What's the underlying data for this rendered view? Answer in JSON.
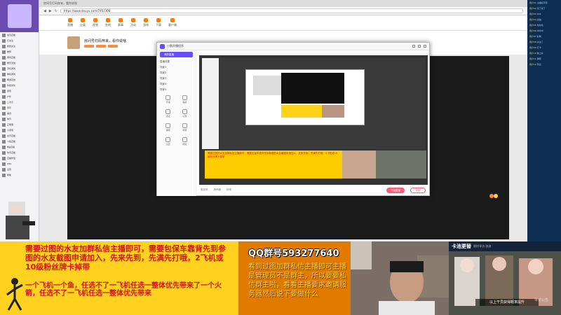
{
  "left_panel": {
    "items": [
      "最近直播",
      "已关注",
      "我的关注",
      "推荐",
      "游戏直播",
      "娱乐天地",
      "手机游戏",
      "单机游戏",
      "网游竞技",
      "科技文化",
      "颜值",
      "户外",
      "二次元",
      "音乐",
      "美食",
      "体育",
      "正能量",
      "小游戏",
      "虎牙直播",
      "斗鱼直播",
      "B站直播",
      "快手直播",
      "直播伴侣",
      "OBS",
      "设置",
      "帮助"
    ]
  },
  "browser": {
    "url": "https://www.douyu.com/7457308",
    "room_title": "房间号打码奔来，看你说啥",
    "nav": [
      "直播",
      "分类",
      "视频",
      "鱼吧",
      "赛事",
      "活动",
      "游戏",
      "下载",
      "客户端"
    ],
    "logo": "斗鱼"
  },
  "tool": {
    "title": "小鹅开播程序",
    "side_items": [
      "我的直播",
      "直播设置",
      "场景1",
      "场景2",
      "场景3",
      "场景4",
      "场景5"
    ],
    "grid_items": [
      "开播",
      "美颜",
      "连麦",
      "礼物",
      "弹幕",
      "录屏",
      "设置",
      "帮助"
    ],
    "bottom_items": [
      "麦克风",
      "扬声器",
      "码率"
    ],
    "live_button": "开始直播",
    "record_button": "录制"
  },
  "right_panel": {
    "rows": [
      {
        "user": "用户01",
        "text": "主播好厉害"
      },
      {
        "user": "用户02",
        "text": "来了来了"
      },
      {
        "user": "用户03",
        "text": "666"
      },
      {
        "user": "用户04",
        "text": "加油"
      },
      {
        "user": "用户05",
        "text": "哈哈哈"
      },
      {
        "user": "用户06",
        "text": "冲冲冲"
      },
      {
        "user": "用户07",
        "text": "好看"
      },
      {
        "user": "用户08",
        "text": "关注了"
      },
      {
        "user": "用户09",
        "text": "打卡"
      },
      {
        "user": "用户10",
        "text": "晚上好"
      },
      {
        "user": "用户11",
        "text": "弹幕"
      },
      {
        "user": "用户12",
        "text": "欢迎"
      }
    ]
  },
  "bottom": {
    "msg1": "需要过图的水友加群私信主播即可，需要包保车靠背先到参图的水友截图申请加入，先来先到，先满先打哦，2飞机或10级粉丝牌卡掉带",
    "msg2": "一个飞机一个鱼，任选不了一飞机任选一整体优先带来了一个火箭，任选不了一飞机任选一整体优先带来",
    "qq": "QQ群号593277640",
    "info": "看到过图加群私信主播即可主播是管理员不是群主，所以要要私信群主啦，看看主播要求邀请服务器然后说下要做什么",
    "anime_title": "卡池更替",
    "anime_sub": "限时寻访·浊流",
    "anime_banner": "以上干员获得概率提升",
    "anime_side": "寻访公告"
  }
}
